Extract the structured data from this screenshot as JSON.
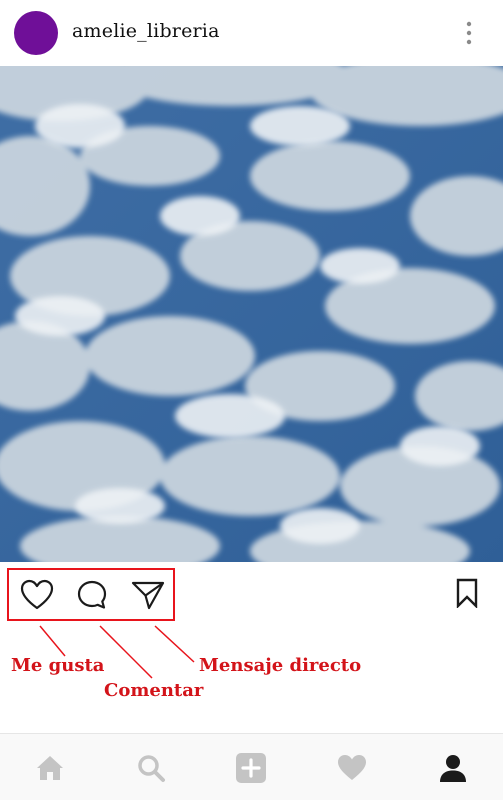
{
  "post": {
    "username": "amelie_libreria",
    "avatar_color": "#6f0f98",
    "image": "sky-with-clouds"
  },
  "actions": {
    "like_icon": "heart-icon",
    "comment_icon": "comment-icon",
    "share_icon": "paper-plane-icon",
    "save_icon": "bookmark-icon"
  },
  "annotations": {
    "like_label": "Me gusta",
    "comment_label": "Comentar",
    "direct_label": "Mensaje directo",
    "color": "#e8141c"
  },
  "bottom_nav": {
    "items": [
      "home-icon",
      "search-icon",
      "add-icon",
      "activity-heart-icon",
      "profile-icon"
    ],
    "active": "profile-icon"
  }
}
